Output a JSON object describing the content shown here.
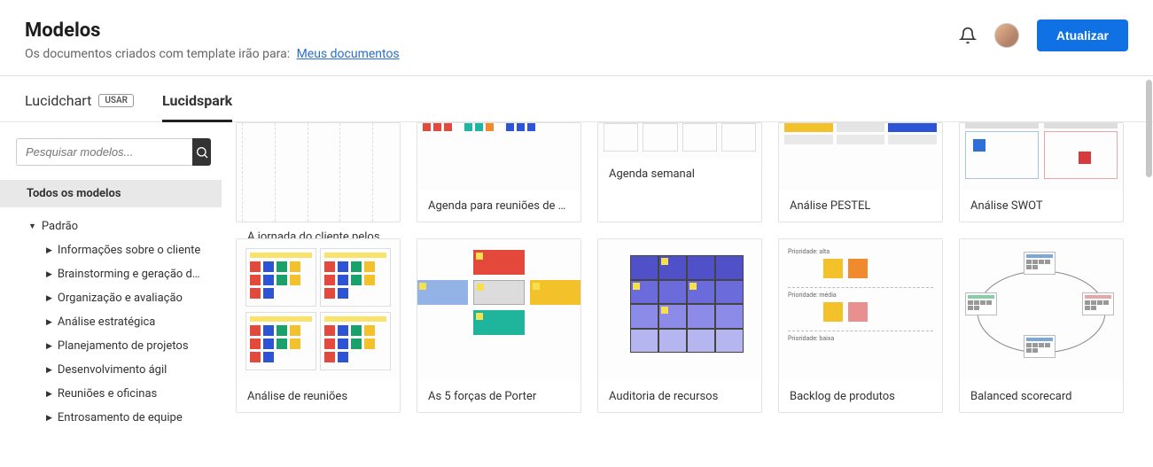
{
  "header": {
    "title": "Modelos",
    "subtitle_prefix": "Os documentos criados com template irão para:",
    "subtitle_link": "Meus documentos",
    "update_button": "Atualizar"
  },
  "tabs": {
    "lucidchart": "Lucidchart",
    "lucidchart_badge": "USAR",
    "lucidspark": "Lucidspark"
  },
  "search": {
    "placeholder": "Pesquisar modelos..."
  },
  "sidebar": {
    "all_templates": "Todos os modelos",
    "root": "Padrão",
    "items": [
      "Informações sobre o cliente",
      "Brainstorming e geração d…",
      "Organização e avaliação",
      "Análise estratégica",
      "Planejamento de projetos",
      "Desenvolvimento ágil",
      "Reuniões e oficinas",
      "Entrosamento de equipe"
    ]
  },
  "cards_row1": [
    "A jornada do cliente pelos…",
    "Agenda para reuniões de …",
    "Agenda semanal",
    "Análise PESTEL",
    "Análise SWOT"
  ],
  "cards_row2": [
    "Análise de reuniões",
    "As 5 forças de Porter",
    "Auditoria de recursos",
    "Backlog de produtos",
    "Balanced scorecard"
  ],
  "colors": {
    "red": "#e34a3b",
    "blue": "#2d53d6",
    "green": "#1aa06a",
    "yellow": "#f3c22b",
    "teal": "#1fb5a5",
    "orange": "#f08a2c",
    "navy": "#2b3ea8",
    "heat1": "#5050c8",
    "heat2": "#6b6bdc",
    "heat3": "#8c8ce8",
    "heat4": "#b5b5f0",
    "porter_red": "#e3483a",
    "porter_teal": "#1fb59c",
    "porter_blue": "#93b2e6",
    "porter_yellow": "#f3c22b"
  },
  "backlog_labels": [
    "Prioridade: alta",
    "Prioridade: média",
    "Prioridade: baixa"
  ]
}
